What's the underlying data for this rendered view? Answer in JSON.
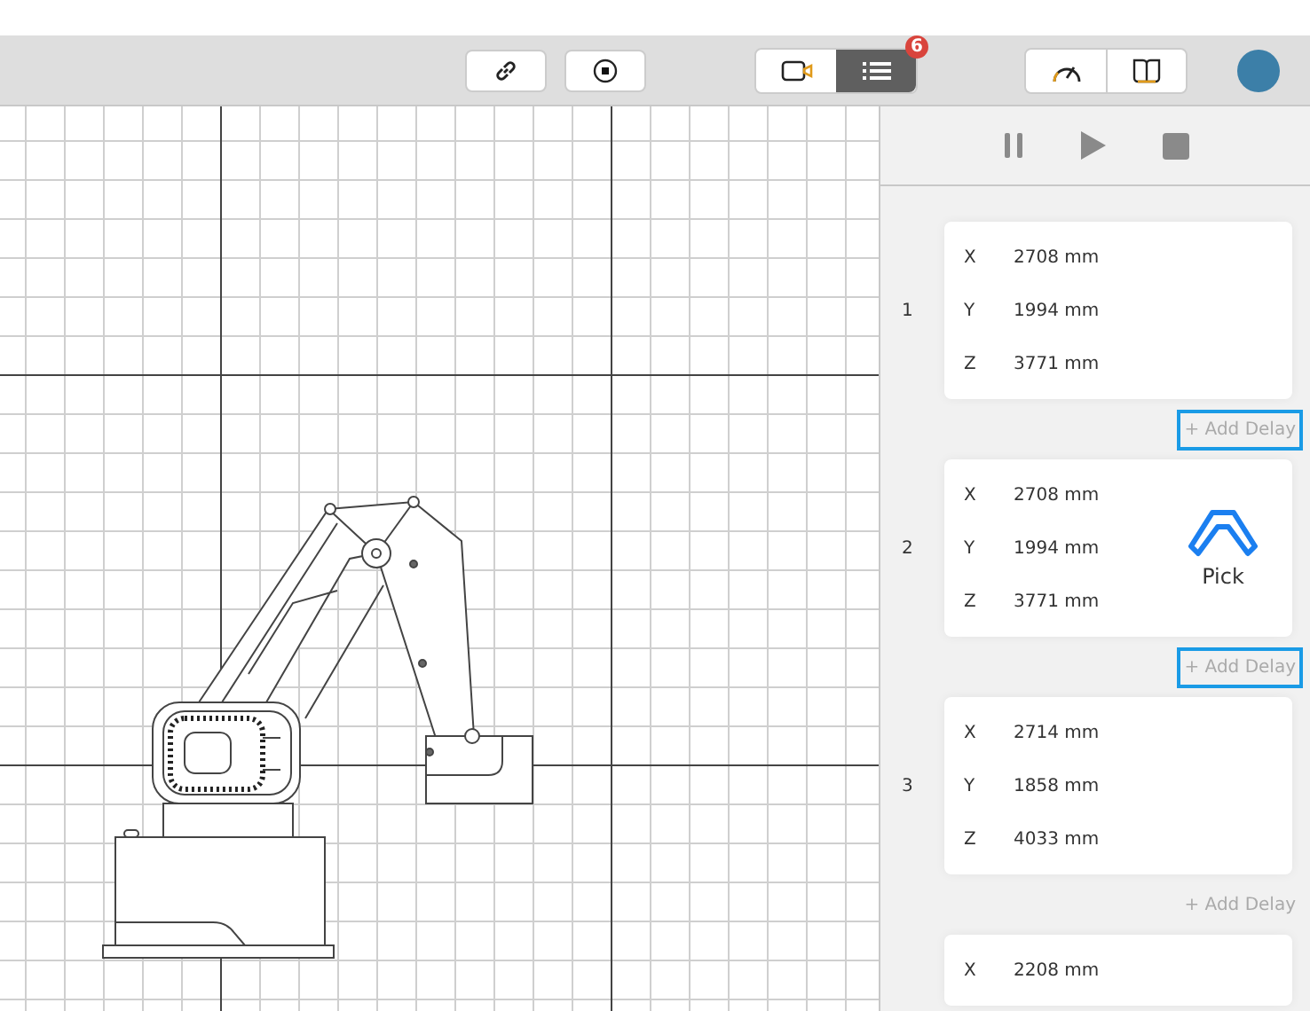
{
  "toolbar": {
    "tool_buttons": [
      {
        "kind": "link"
      },
      {
        "kind": "stop"
      }
    ],
    "view_toggle": [
      {
        "kind": "camera",
        "selected": false
      },
      {
        "kind": "list",
        "selected": true,
        "badge": "6"
      }
    ],
    "info_buttons": [
      {
        "kind": "speed"
      },
      {
        "kind": "book"
      }
    ]
  },
  "playback": [
    {
      "kind": "pause"
    },
    {
      "kind": "play"
    },
    {
      "kind": "stop"
    }
  ],
  "points": [
    {
      "number": "1",
      "coords": [
        {
          "axis": "X",
          "value": "2708 mm"
        },
        {
          "axis": "Y",
          "value": "1994 mm"
        },
        {
          "axis": "Z",
          "value": "3771 mm"
        }
      ],
      "add_delay": {
        "label": "+ Add Delay",
        "highlighted": true
      }
    },
    {
      "number": "2",
      "coords": [
        {
          "axis": "X",
          "value": "2708 mm"
        },
        {
          "axis": "Y",
          "value": "1994 mm"
        },
        {
          "axis": "Z",
          "value": "3771 mm"
        }
      ],
      "action": {
        "kind": "pick",
        "label": "Pick"
      },
      "add_delay": {
        "label": "+ Add Delay",
        "highlighted": true
      }
    },
    {
      "number": "3",
      "coords": [
        {
          "axis": "X",
          "value": "2714 mm"
        },
        {
          "axis": "Y",
          "value": "1858 mm"
        },
        {
          "axis": "Z",
          "value": "4033 mm"
        }
      ],
      "add_delay": {
        "label": "+ Add Delay",
        "highlighted": false
      }
    },
    {
      "coords": [
        {
          "axis": "X",
          "value": "2208 mm"
        }
      ]
    }
  ]
}
